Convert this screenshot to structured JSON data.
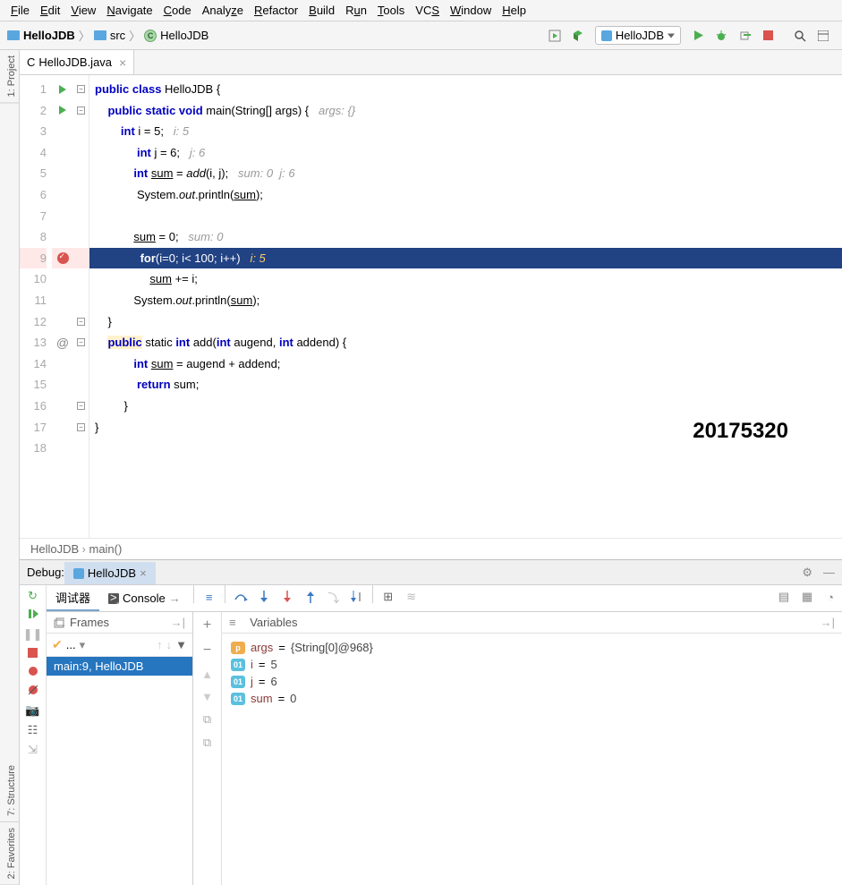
{
  "menu": [
    "File",
    "Edit",
    "View",
    "Navigate",
    "Code",
    "Analyze",
    "Refactor",
    "Build",
    "Run",
    "Tools",
    "VCS",
    "Window",
    "Help"
  ],
  "breadcrumbs": {
    "root": "HelloJDB",
    "src": "src",
    "file": "HelloJDB"
  },
  "run_config": "HelloJDB",
  "editor_tab": "HelloJDB.java",
  "watermark": "20175320",
  "nav_trail": {
    "class": "HelloJDB",
    "method": "main()"
  },
  "code": {
    "l1": "public class HelloJDB {",
    "l2_a": "public static void",
    "l2_b": " main(String[] args) {   ",
    "l2_c": "args: {}",
    "l3_a": "int",
    "l3_b": " i = 5;   ",
    "l3_c": "i: 5",
    "l4_a": "int",
    "l4_b": " j = 6;   ",
    "l4_c": "j: 6",
    "l5_a": "int ",
    "l5_sum": "sum",
    "l5_b": " = ",
    "l5_add": "add",
    "l5_c": "(i, j);   ",
    "l5_d": "sum: 0  j: 6",
    "l6_a": "System.",
    "l6_out": "out",
    "l6_b": ".println(",
    "l6_sum": "sum",
    "l6_c": ");",
    "l8_sum": "sum",
    "l8_b": " = 0;   ",
    "l8_c": "sum: 0",
    "l9_a": "for",
    "l9_b": "(i=0; i< 100; i++)   ",
    "l9_c": "i: 5",
    "l10_sum": "sum",
    "l10_b": " += i;",
    "l11_a": "System.",
    "l11_out": "out",
    "l11_b": ".println(",
    "l11_sum": "sum",
    "l11_c": ");",
    "l13_a": "public",
    "l13_b": " static ",
    "l13_c": "int",
    "l13_d": " add(",
    "l13_e": "int",
    "l13_f": " augend, ",
    "l13_g": "int",
    "l13_h": " addend) {",
    "l14_a": "int ",
    "l14_sum": "sum",
    "l14_b": " = augend + addend;",
    "l15_a": "return",
    "l15_b": " sum;"
  },
  "sidebars": {
    "project": "1: Project",
    "structure": "7: Structure",
    "favorites": "2: Favorites"
  },
  "debug": {
    "label": "Debug:",
    "tab": "HelloJDB",
    "sub_tabs": {
      "debugger": "调试器",
      "console": "Console"
    },
    "frames_title": "Frames",
    "vars_title": "Variables",
    "frame_item": "main:9, HelloJDB",
    "vars": [
      {
        "badge": "p",
        "name": "args",
        "eq": " = ",
        "val": "{String[0]@968}"
      },
      {
        "badge": "01",
        "name": "i",
        "eq": " = ",
        "val": "5"
      },
      {
        "badge": "01",
        "name": "j",
        "eq": " = ",
        "val": "6"
      },
      {
        "badge": "01",
        "name": "sum",
        "eq": " = ",
        "val": "0"
      }
    ],
    "dropdown": "..."
  }
}
